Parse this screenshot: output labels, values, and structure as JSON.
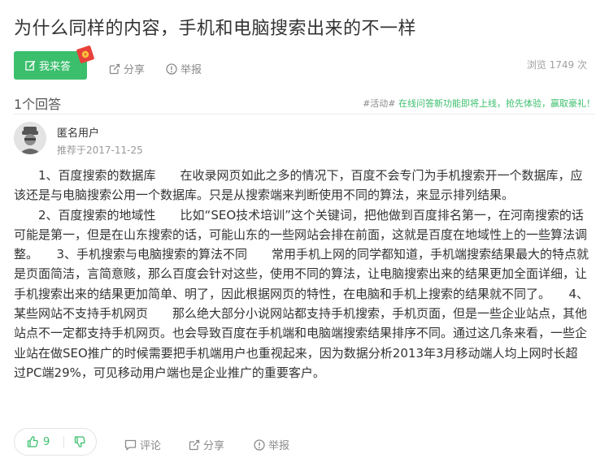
{
  "question": {
    "title": "为什么同样的内容，手机和电脑搜索出来的不一样"
  },
  "toolbar": {
    "answer_label": "我来答",
    "share_label": "分享",
    "report_label": "举报",
    "views_text": "浏览 1749 次"
  },
  "answers_header": {
    "count_text": "1个回答",
    "promo_tag": "#活动#",
    "promo_text": " 在线问答新功能即将上线，抢先体验，赢取豪礼！"
  },
  "answer": {
    "user_name": "匿名用户",
    "date_text": "推荐于2017-11-25",
    "paragraphs": [
      "1、百度搜索的数据库　　在收录网页如此之多的情况下，百度不会专门为手机搜索开一个数据库，应该还是与电脑搜索公用一个数据库。只是从搜索端来判断使用不同的算法，来显示排列结果。",
      "2、百度搜索的地域性　　比如“SEO技术培训”这个关键词，把他做到百度排名第一，在河南搜索的话可能是第一，但是在山东搜索的话，可能山东的一些网站会排在前面，这就是百度在地域性上的一些算法调整。　　3、手机搜索与电脑搜索的算法不同　　常用手机上网的同学都知道，手机端搜索结果最大的特点就是页面简洁，言简意赅，那么百度会针对这些，使用不同的算法，让电脑搜索出来的结果更加全面详细，让手机搜索出来的结果更加简单、明了，因此根据网页的特性，在电脑和手机上搜索的结果就不同了。　　4、某些网站不支持手机网页　　那么绝大部分小说网站都支持手机搜索，手机页面，但是一些企业站点，其他站点不一定都支持手机网页。也会导致百度在手机端和电脑端搜索结果排序不同。通过这几条来看，一些企业站在做SEO推广的时候需要把手机端用户也重视起来，因为数据分析2013年3月移动端人均上网时长超过PC端29%，可见移动用户端也是企业推广的重要客户。"
    ],
    "upvotes": "9",
    "comment_label": "评论",
    "share_label": "分享",
    "report_label": "举报"
  },
  "colors": {
    "accent_green": "#3bbf6d",
    "muted_gray": "#8a8a8a",
    "divider": "#ececec"
  }
}
